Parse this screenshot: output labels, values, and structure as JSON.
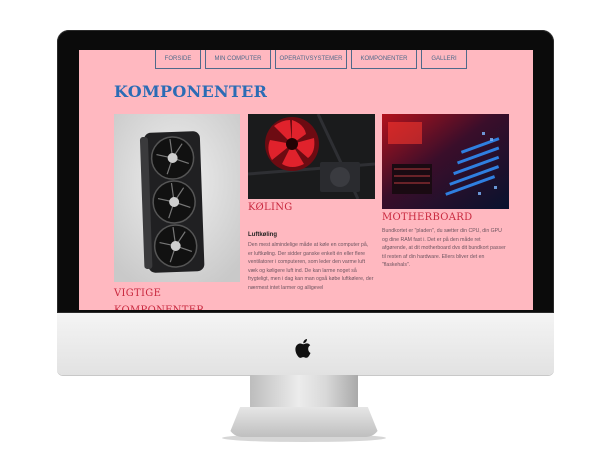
{
  "nav": {
    "items": [
      "FORSIDE",
      "MIN COMPUTER",
      "OPERATIVSYSTEMER",
      "KOMPONENTER",
      "GALLERI"
    ]
  },
  "page": {
    "title": "KOMPONENTER"
  },
  "columns": {
    "left": {
      "title": "VIGTIGE KOMPONENTER",
      "image": "graphics-card-photo"
    },
    "middle": {
      "title": "KØLING",
      "image": "cpu-cooler-red-fan-photo",
      "subheading": "Luftkøling",
      "text": "Den mest almindelige måde at køle en computer på, er luftkøling. Der sidder ganske enkelt én eller flere ventilatorer i computeren, som leder den varme luft væk og køligere luft ind. De kan larme noget så frygteligt, men i dag kan man også købe luftkølere, der nærmest intet larmer og alligevel"
    },
    "right": {
      "title": "MOTHERBOARD",
      "image": "motherboard-red-blue-photo",
      "text": "Bundkortet er \"pladen\", du sætter din CPU, din GPU og dine RAM fast i. Det er på den måde ret afgørende, at dit motherboard dvs dit bundkort passer til resten af din hardware. Ellers bliver det en \"flaskehals\"."
    }
  },
  "colors": {
    "background": "#ffb8c0",
    "nav": "#4f6a8a",
    "title": "#2b6cb5",
    "section_title": "#c9293f"
  },
  "icons": {
    "device": "apple-logo-icon"
  }
}
